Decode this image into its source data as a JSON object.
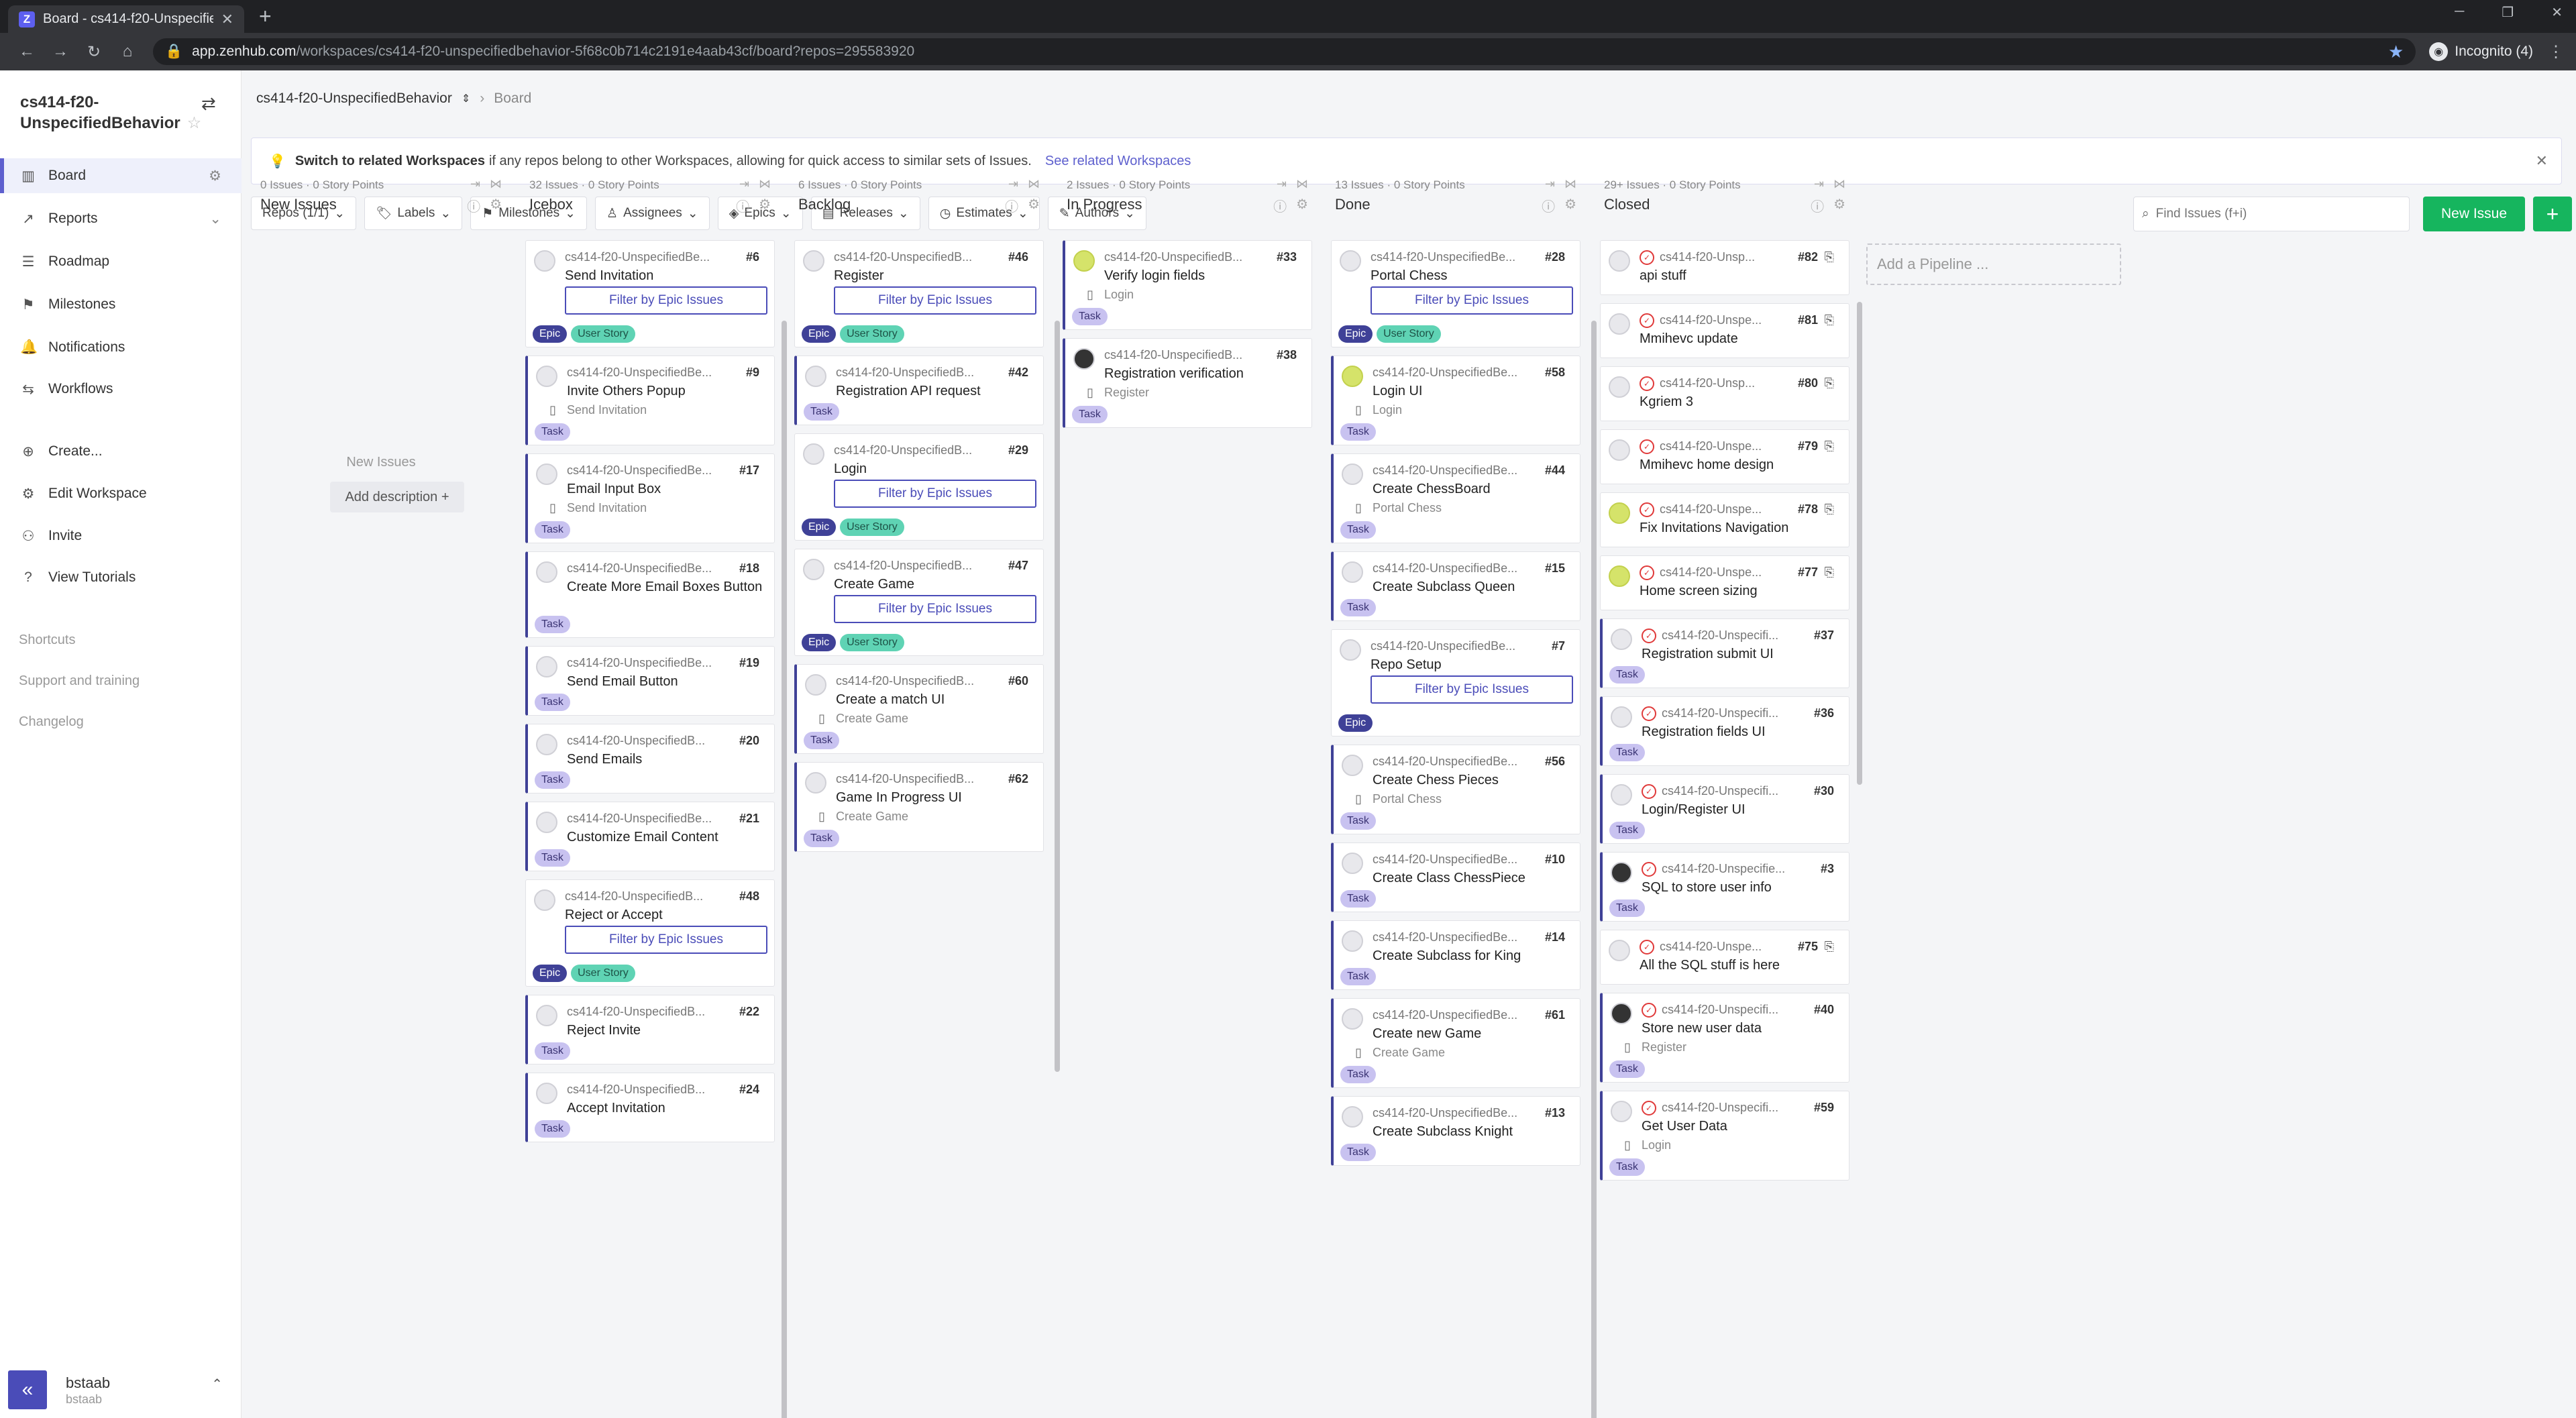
{
  "browser": {
    "tab_title": "Board - cs414-f20-UnspecifiedBe",
    "url_host": "app.zenhub.com",
    "url_path": "/workspaces/cs414-f20-unspecifiedbehavior-5f68c0b714c2191e4aab43cf/board?repos=295583920",
    "incognito_label": "Incognito (4)"
  },
  "sidebar": {
    "workspace_name": "cs414-f20-UnspecifiedBehavior",
    "nav": [
      {
        "label": "Board",
        "icon": "board-icon"
      },
      {
        "label": "Reports",
        "icon": "reports-icon"
      },
      {
        "label": "Roadmap",
        "icon": "roadmap-icon"
      },
      {
        "label": "Milestones",
        "icon": "milestones-icon"
      },
      {
        "label": "Notifications",
        "icon": "bell-icon"
      },
      {
        "label": "Workflows",
        "icon": "workflows-icon"
      }
    ],
    "actions": [
      {
        "label": "Create...",
        "icon": "plus-circle-icon"
      },
      {
        "label": "Edit Workspace",
        "icon": "gear-icon"
      },
      {
        "label": "Invite",
        "icon": "invite-icon"
      },
      {
        "label": "View Tutorials",
        "icon": "help-icon"
      }
    ],
    "links": [
      "Shortcuts",
      "Support and training",
      "Changelog"
    ],
    "user": {
      "name": "bstaab",
      "handle": "bstaab"
    }
  },
  "header": {
    "workspace_crumb": "cs414-f20-UnspecifiedBehavior",
    "page_crumb": "Board"
  },
  "banner": {
    "bold": "Switch to related Workspaces",
    "text": "if any repos belong to other Workspaces, allowing for quick access to similar sets of Issues.",
    "link": "See related Workspaces"
  },
  "filters": [
    "Repos (1/1)",
    "Labels",
    "Milestones",
    "Assignees",
    "Epics",
    "Releases",
    "Estimates",
    "Authors"
  ],
  "search": {
    "placeholder": "Find Issues (f+i)"
  },
  "new_issue_label": "New Issue",
  "add_pipeline_label": "Add a Pipeline ...",
  "pipelines": [
    {
      "name": "New Issues",
      "count": "0 Issues",
      "points": "· 0 Story Points",
      "empty_title": "New Issues",
      "empty_action": "Add description +"
    },
    {
      "name": "Icebox",
      "count": "32 Issues",
      "points": "· 0 Story Points"
    },
    {
      "name": "Backlog",
      "count": "6 Issues",
      "points": "· 0 Story Points"
    },
    {
      "name": "In Progress",
      "count": "2 Issues",
      "points": "· 0 Story Points"
    },
    {
      "name": "Done",
      "count": "13 Issues",
      "points": "· 0 Story Points"
    },
    {
      "name": "Closed",
      "count": "29+ Issues",
      "points": "· 0 Story Points"
    }
  ],
  "cards": {
    "icebox": [
      {
        "repo": "cs414-f20-UnspecifiedBe...",
        "num": "#6",
        "title": "Send Invitation",
        "filter": "Filter by Epic Issues",
        "labels": [
          "Epic",
          "User Story"
        ]
      },
      {
        "repo": "cs414-f20-UnspecifiedBe...",
        "num": "#9",
        "title": "Invite Others Popup",
        "sub": "Send Invitation",
        "labels": [
          "Task"
        ]
      },
      {
        "repo": "cs414-f20-UnspecifiedBe...",
        "num": "#17",
        "title": "Email Input Box",
        "sub": "Send Invitation",
        "labels": [
          "Task"
        ]
      },
      {
        "repo": "cs414-f20-UnspecifiedBe...",
        "num": "#18",
        "title": "Create More Email Boxes Button",
        "labels": [
          "Task"
        ]
      },
      {
        "repo": "cs414-f20-UnspecifiedBe...",
        "num": "#19",
        "title": "Send Email Button",
        "labels": [
          "Task"
        ]
      },
      {
        "repo": "cs414-f20-UnspecifiedB...",
        "num": "#20",
        "title": "Send Emails",
        "labels": [
          "Task"
        ]
      },
      {
        "repo": "cs414-f20-UnspecifiedBe...",
        "num": "#21",
        "title": "Customize Email Content",
        "labels": [
          "Task"
        ]
      },
      {
        "repo": "cs414-f20-UnspecifiedB...",
        "num": "#48",
        "title": "Reject or Accept",
        "filter": "Filter by Epic Issues",
        "labels": [
          "Epic",
          "User Story"
        ]
      },
      {
        "repo": "cs414-f20-UnspecifiedB...",
        "num": "#22",
        "title": "Reject Invite",
        "labels": [
          "Task"
        ]
      },
      {
        "repo": "cs414-f20-UnspecifiedB...",
        "num": "#24",
        "title": "Accept Invitation",
        "labels": [
          "Task"
        ]
      }
    ],
    "backlog": [
      {
        "repo": "cs414-f20-UnspecifiedB...",
        "num": "#46",
        "title": "Register",
        "filter": "Filter by Epic Issues",
        "labels": [
          "Epic",
          "User Story"
        ]
      },
      {
        "repo": "cs414-f20-UnspecifiedB...",
        "num": "#42",
        "title": "Registration API request",
        "labels": [
          "Task"
        ]
      },
      {
        "repo": "cs414-f20-UnspecifiedB...",
        "num": "#29",
        "title": "Login",
        "filter": "Filter by Epic Issues",
        "labels": [
          "Epic",
          "User Story"
        ]
      },
      {
        "repo": "cs414-f20-UnspecifiedB...",
        "num": "#47",
        "title": "Create Game",
        "filter": "Filter by Epic Issues",
        "labels": [
          "Epic",
          "User Story"
        ]
      },
      {
        "repo": "cs414-f20-UnspecifiedB...",
        "num": "#60",
        "title": "Create a match UI",
        "sub": "Create Game",
        "labels": [
          "Task"
        ]
      },
      {
        "repo": "cs414-f20-UnspecifiedB...",
        "num": "#62",
        "title": "Game In Progress UI",
        "sub": "Create Game",
        "labels": [
          "Task"
        ]
      }
    ],
    "inprogress": [
      {
        "repo": "cs414-f20-UnspecifiedB...",
        "num": "#33",
        "title": "Verify login fields",
        "sub": "Login",
        "labels": [
          "Task"
        ]
      },
      {
        "repo": "cs414-f20-UnspecifiedB...",
        "num": "#38",
        "title": "Registration verification",
        "sub": "Register",
        "labels": [
          "Task"
        ]
      }
    ],
    "done": [
      {
        "repo": "cs414-f20-UnspecifiedBe...",
        "num": "#28",
        "title": "Portal Chess",
        "filter": "Filter by Epic Issues",
        "labels": [
          "Epic",
          "User Story"
        ]
      },
      {
        "repo": "cs414-f20-UnspecifiedBe...",
        "num": "#58",
        "title": "Login UI",
        "sub": "Login",
        "labels": [
          "Task"
        ]
      },
      {
        "repo": "cs414-f20-UnspecifiedBe...",
        "num": "#44",
        "title": "Create ChessBoard",
        "sub": "Portal Chess",
        "labels": [
          "Task"
        ]
      },
      {
        "repo": "cs414-f20-UnspecifiedBe...",
        "num": "#15",
        "title": "Create Subclass Queen",
        "labels": [
          "Task"
        ]
      },
      {
        "repo": "cs414-f20-UnspecifiedBe...",
        "num": "#7",
        "title": "Repo Setup",
        "filter": "Filter by Epic Issues",
        "labels": [
          "Epic"
        ]
      },
      {
        "repo": "cs414-f20-UnspecifiedBe...",
        "num": "#56",
        "title": "Create Chess Pieces",
        "sub": "Portal Chess",
        "labels": [
          "Task"
        ]
      },
      {
        "repo": "cs414-f20-UnspecifiedBe...",
        "num": "#10",
        "title": "Create Class ChessPiece",
        "labels": [
          "Task"
        ]
      },
      {
        "repo": "cs414-f20-UnspecifiedBe...",
        "num": "#14",
        "title": "Create Subclass for King",
        "labels": [
          "Task"
        ]
      },
      {
        "repo": "cs414-f20-UnspecifiedBe...",
        "num": "#61",
        "title": "Create new Game",
        "sub": "Create Game",
        "labels": [
          "Task"
        ]
      },
      {
        "repo": "cs414-f20-UnspecifiedBe...",
        "num": "#13",
        "title": "Create Subclass Knight",
        "labels": [
          "Task"
        ]
      }
    ],
    "closed": [
      {
        "repo": "cs414-f20-Unsp...",
        "num": "#82",
        "title": "api stuff",
        "copy": true
      },
      {
        "repo": "cs414-f20-Unspe...",
        "num": "#81",
        "title": "Mmihevc update",
        "copy": true
      },
      {
        "repo": "cs414-f20-Unsp...",
        "num": "#80",
        "title": "Kgriem 3",
        "copy": true
      },
      {
        "repo": "cs414-f20-Unspe...",
        "num": "#79",
        "title": "Mmihevc home design",
        "copy": true
      },
      {
        "repo": "cs414-f20-Unspe...",
        "num": "#78",
        "title": "Fix Invitations Navigation",
        "copy": true
      },
      {
        "repo": "cs414-f20-Unspe...",
        "num": "#77",
        "title": "Home screen sizing",
        "copy": true
      },
      {
        "repo": "cs414-f20-Unspecifi...",
        "num": "#37",
        "title": "Registration submit UI",
        "labels": [
          "Task"
        ]
      },
      {
        "repo": "cs414-f20-Unspecifi...",
        "num": "#36",
        "title": "Registration fields UI",
        "labels": [
          "Task"
        ]
      },
      {
        "repo": "cs414-f20-Unspecifi...",
        "num": "#30",
        "title": "Login/Register UI",
        "labels": [
          "Task"
        ]
      },
      {
        "repo": "cs414-f20-Unspecifie...",
        "num": "#3",
        "title": "SQL to store user info",
        "labels": [
          "Task"
        ]
      },
      {
        "repo": "cs414-f20-Unspe...",
        "num": "#75",
        "title": "All the SQL stuff is here",
        "copy": true
      },
      {
        "repo": "cs414-f20-Unspecifi...",
        "num": "#40",
        "title": "Store new user data",
        "sub": "Register",
        "labels": [
          "Task"
        ]
      },
      {
        "repo": "cs414-f20-Unspecifi...",
        "num": "#59",
        "title": "Get User Data",
        "sub": "Login",
        "labels": [
          "Task"
        ]
      }
    ]
  }
}
